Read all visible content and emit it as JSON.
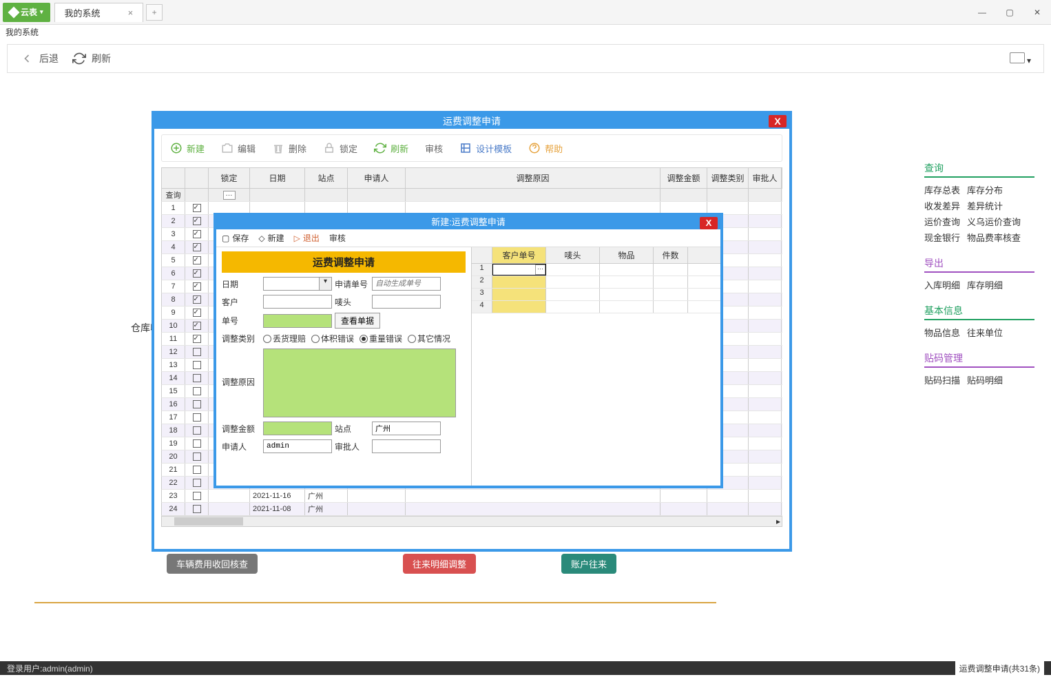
{
  "app": {
    "logo": "云表",
    "tab": "我的系统",
    "subbar": "我的系统"
  },
  "toolbar": {
    "back": "后退",
    "refresh": "刷新"
  },
  "bg_text": "仓库收",
  "main_win": {
    "title": "运费调整申请",
    "toolbar": {
      "new": "新建",
      "edit": "编辑",
      "delete": "删除",
      "lock": "锁定",
      "refresh": "刷新",
      "audit": "审核",
      "design": "设计模板",
      "help": "帮助"
    },
    "headers": {
      "lock": "锁定",
      "date": "日期",
      "site": "站点",
      "applicant": "申请人",
      "reason": "调整原因",
      "amount": "调整金额",
      "type": "调整类别",
      "approver": "审批人"
    },
    "search_label": "查询",
    "rows": [
      {
        "n": 1,
        "chk": true
      },
      {
        "n": 2,
        "chk": true
      },
      {
        "n": 3,
        "chk": true
      },
      {
        "n": 4,
        "chk": true
      },
      {
        "n": 5,
        "chk": true
      },
      {
        "n": 6,
        "chk": true
      },
      {
        "n": 7,
        "chk": true
      },
      {
        "n": 8,
        "chk": true
      },
      {
        "n": 9,
        "chk": true
      },
      {
        "n": 10,
        "chk": true
      },
      {
        "n": 11,
        "chk": true
      },
      {
        "n": 12,
        "chk": false
      },
      {
        "n": 13,
        "chk": false
      },
      {
        "n": 14,
        "chk": false
      },
      {
        "n": 15,
        "chk": false
      },
      {
        "n": 16,
        "chk": false
      },
      {
        "n": 17,
        "chk": false
      },
      {
        "n": 18,
        "chk": false
      },
      {
        "n": 19,
        "chk": false
      },
      {
        "n": 20,
        "chk": false
      },
      {
        "n": 21,
        "chk": false
      },
      {
        "n": 22,
        "chk": false
      },
      {
        "n": 23,
        "chk": false,
        "date": "2021-11-16",
        "site": "广州"
      },
      {
        "n": 24,
        "chk": false,
        "date": "2021-11-08",
        "site": "广州"
      }
    ]
  },
  "dlg": {
    "title": "新建:运费调整申请",
    "toolbar": {
      "save": "保存",
      "new": "新建",
      "exit": "退出",
      "audit": "审核"
    },
    "form_title": "运费调整申请",
    "labels": {
      "date": "日期",
      "apply_no": "申请单号",
      "apply_no_ph": "自动生成单号",
      "customer": "客户",
      "mark": "唛头",
      "order_no": "单号",
      "view_order": "查看单据",
      "adj_type": "调整类别",
      "r1": "丢货理赔",
      "r2": "体积错误",
      "r3": "重量错误",
      "r4": "其它情况",
      "reason": "调整原因",
      "amount": "调整金额",
      "site": "站点",
      "site_val": "广州",
      "applicant": "申请人",
      "applicant_val": "admin",
      "approver": "审批人"
    },
    "detail_headers": {
      "customer_no": "客户单号",
      "mark": "唛头",
      "goods": "物品",
      "qty": "件数"
    },
    "detail_rows": [
      1,
      2,
      3,
      4
    ]
  },
  "sidebar": {
    "query": {
      "title": "查询",
      "links": [
        "库存总表",
        "库存分布",
        "收发差异",
        "差异统计",
        "运价查询",
        "义乌运价查询",
        "现金银行",
        "物品费率核查"
      ]
    },
    "export": {
      "title": "导出",
      "links": [
        "入库明细",
        "库存明细"
      ]
    },
    "basic": {
      "title": "基本信息",
      "links": [
        "物品信息",
        "往来单位"
      ]
    },
    "label": {
      "title": "贴码管理",
      "links": [
        "贴码扫描",
        "贴码明细"
      ]
    }
  },
  "pills": {
    "p1": "车辆费用收回核查",
    "p2": "往来明细调整",
    "p3": "账户往来"
  },
  "status": {
    "left": "登录用户:admin(admin)",
    "right": "运费调整申请(共31条)"
  }
}
